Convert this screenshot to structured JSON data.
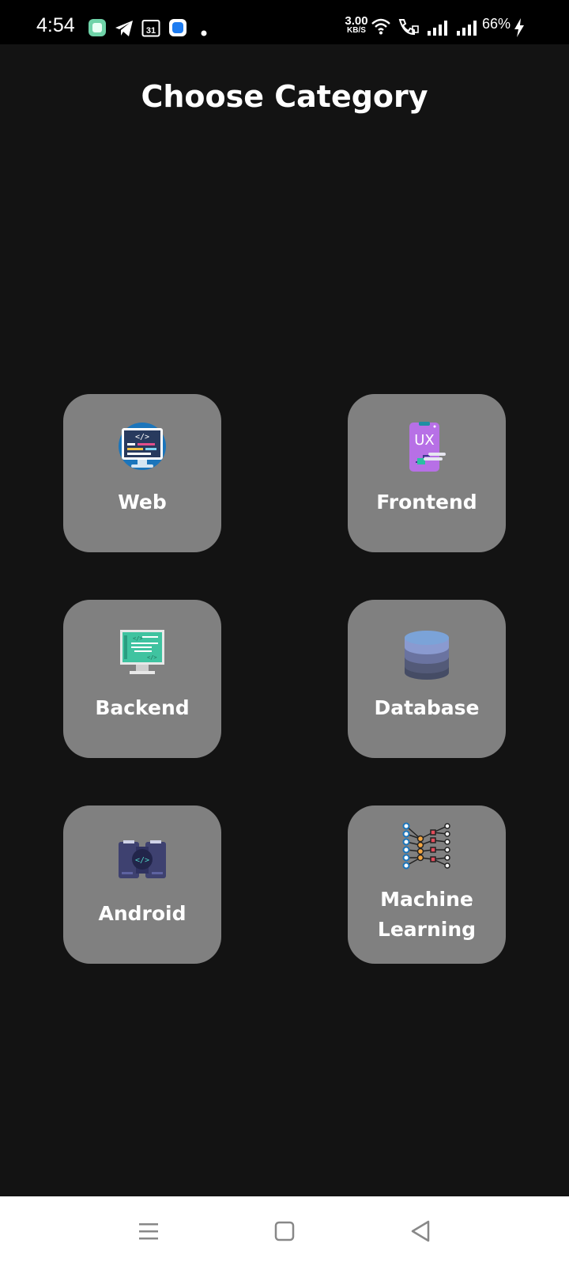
{
  "status_bar": {
    "time": "4:54",
    "net_speed_value": "3.00",
    "net_speed_unit": "KB/S",
    "battery": "66%",
    "calendar_day": "31"
  },
  "page": {
    "title": "Choose Category"
  },
  "categories": [
    {
      "label": "Web",
      "icon": "web-code-monitor-icon"
    },
    {
      "label": "Frontend",
      "icon": "ux-phone-icon"
    },
    {
      "label": "Backend",
      "icon": "code-monitor-icon"
    },
    {
      "label": "Database",
      "icon": "database-stack-icon"
    },
    {
      "label": "Android",
      "icon": "android-code-icon"
    },
    {
      "label": "Machine Learning",
      "icon": "neural-network-icon",
      "label_line1": "Machine",
      "label_line2": "Learning"
    }
  ],
  "nav": {
    "items": [
      "menu-icon",
      "home-square-icon",
      "back-triangle-icon"
    ]
  },
  "colors": {
    "background": "#131313",
    "card": "#808080",
    "statusbar": "#000000",
    "navbar": "#ffffff"
  }
}
